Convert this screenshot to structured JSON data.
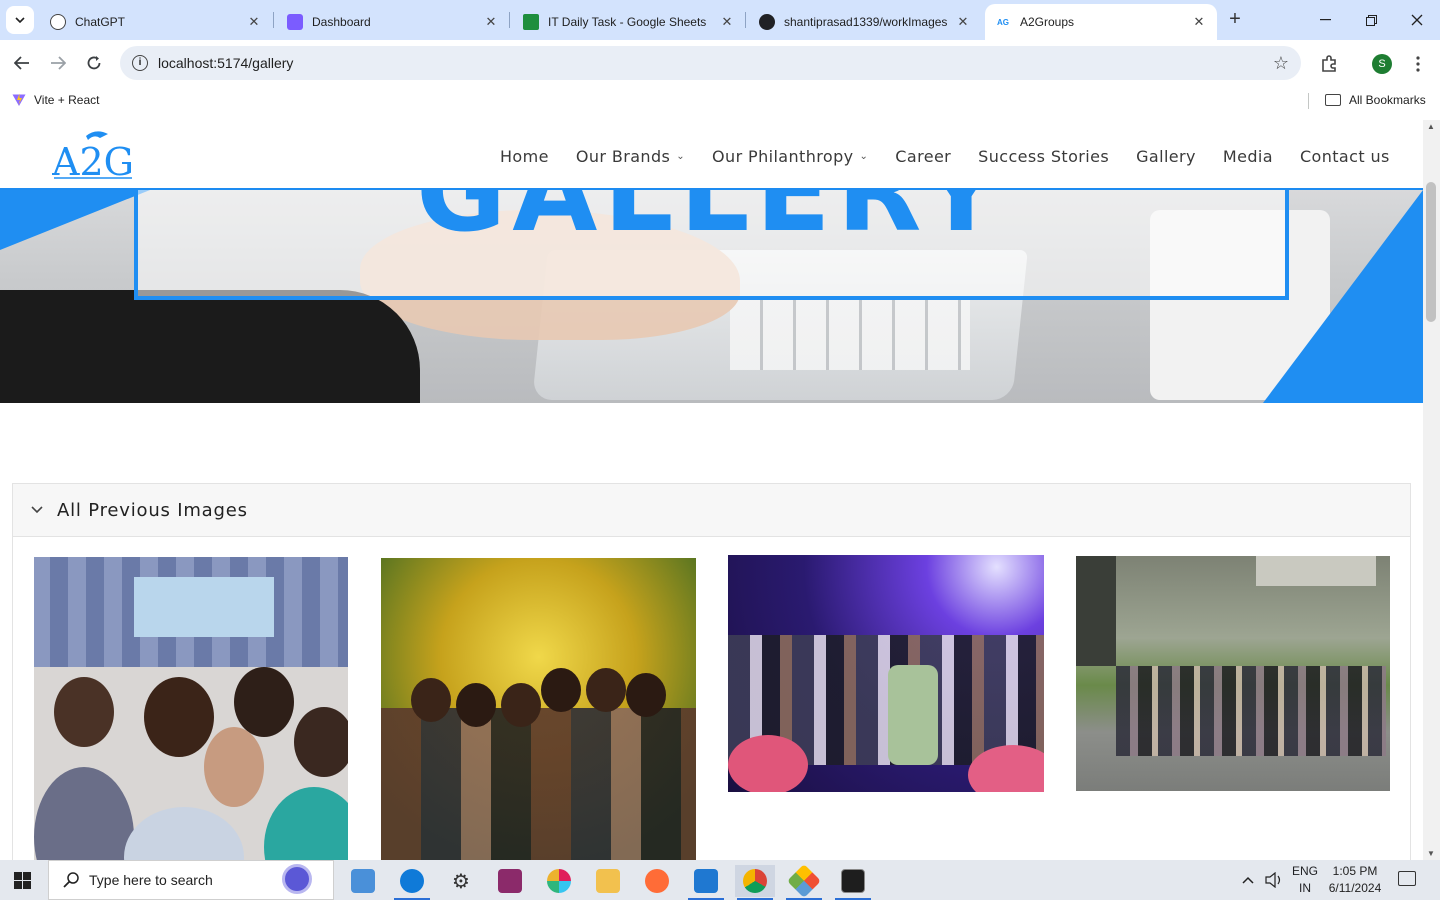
{
  "browser": {
    "tabs": [
      {
        "title": "ChatGPT",
        "icon": "chatgpt-icon",
        "color": "#202124"
      },
      {
        "title": "Dashboard",
        "icon": "dashboard-icon",
        "color": "#7b5cff"
      },
      {
        "title": "IT Daily Task - Google Sheets",
        "icon": "sheets-icon",
        "color": "#1e8e3e"
      },
      {
        "title": "shantiprasad1339/workImages",
        "icon": "github-icon",
        "color": "#202124"
      },
      {
        "title": "A2Groups",
        "icon": "a2g-icon",
        "color": "#1f8ef2"
      }
    ],
    "url": "localhost:5174/gallery",
    "profile_initial": "S",
    "bookmarks": [
      {
        "label": "Vite + React"
      }
    ],
    "all_bookmarks_label": "All Bookmarks"
  },
  "site": {
    "logo_text": "A2G",
    "nav": [
      {
        "label": "Home",
        "has_dropdown": false
      },
      {
        "label": "Our Brands",
        "has_dropdown": true
      },
      {
        "label": "Our Philanthropy",
        "has_dropdown": true
      },
      {
        "label": "Career",
        "has_dropdown": false
      },
      {
        "label": "Success Stories",
        "has_dropdown": false
      },
      {
        "label": "Gallery",
        "has_dropdown": false
      },
      {
        "label": "Media",
        "has_dropdown": false
      },
      {
        "label": "Contact us",
        "has_dropdown": false
      }
    ],
    "hero_title": "GALLERY",
    "accent_color": "#1f8ef2",
    "accordion_title": "All Previous Images"
  },
  "taskbar": {
    "search_placeholder": "Type here to search",
    "lang_line1": "ENG",
    "lang_line2": "IN",
    "time": "1:05 PM",
    "date": "6/11/2024"
  }
}
